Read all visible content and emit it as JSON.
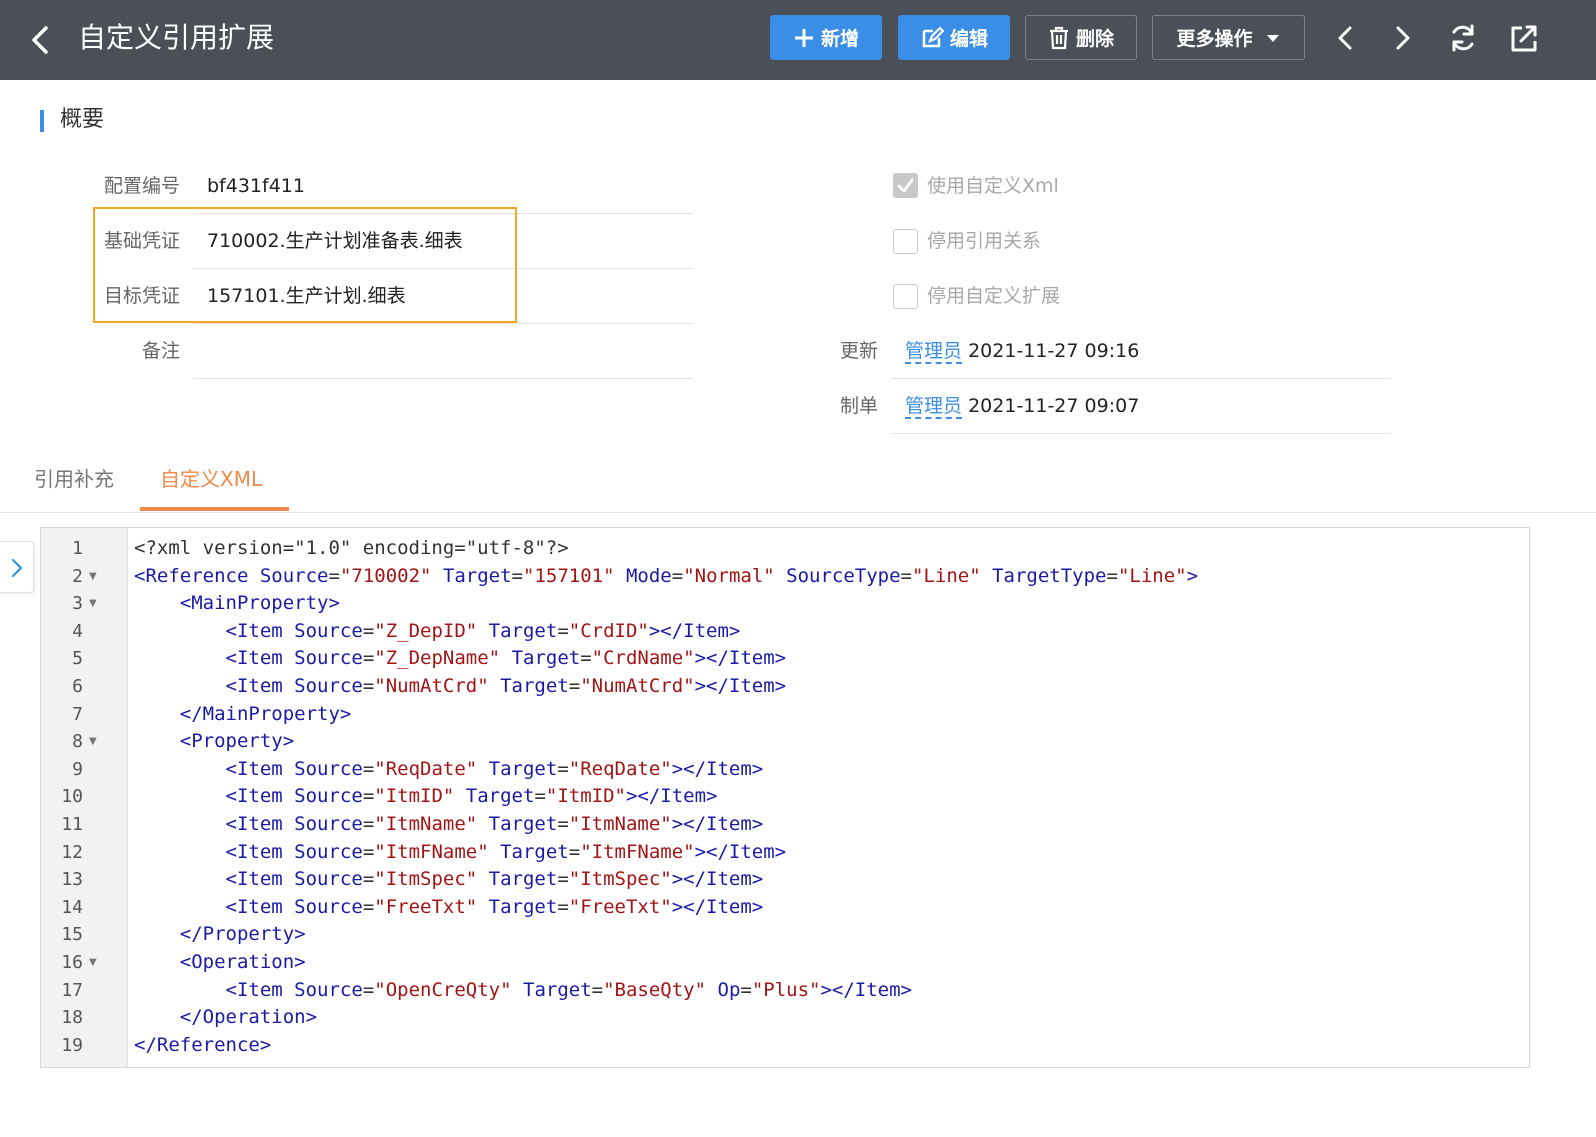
{
  "header": {
    "title": "自定义引用扩展",
    "buttons": {
      "add": "新增",
      "edit": "编辑",
      "delete": "删除",
      "more": "更多操作"
    }
  },
  "overview": {
    "section_title": "概要",
    "fields": {
      "config_no": {
        "label": "配置编号",
        "value": "bf431f411"
      },
      "base_voucher": {
        "label": "基础凭证",
        "value": "710002.生产计划准备表.细表"
      },
      "target_voucher": {
        "label": "目标凭证",
        "value": "157101.生产计划.细表"
      },
      "remark": {
        "label": "备注",
        "value": ""
      },
      "updated": {
        "label": "更新",
        "user": "管理员",
        "time": "2021-11-27 09:16"
      },
      "created": {
        "label": "制单",
        "user": "管理员",
        "time": "2021-11-27 09:07"
      }
    },
    "checkboxes": {
      "use_custom_xml": {
        "label": "使用自定义Xml",
        "checked": true
      },
      "disable_reference": {
        "label": "停用引用关系",
        "checked": false
      },
      "disable_custom_ext": {
        "label": "停用自定义扩展",
        "checked": false
      }
    }
  },
  "tabs": {
    "tab1": "引用补充",
    "tab2": "自定义XML"
  },
  "editor": {
    "line_numbers": [
      "1",
      "2",
      "3",
      "4",
      "5",
      "6",
      "7",
      "8",
      "9",
      "10",
      "11",
      "12",
      "13",
      "14",
      "15",
      "16",
      "17",
      "18",
      "19"
    ],
    "lines": [
      "<?xml version=\"1.0\" encoding=\"utf-8\"?>",
      "<Reference Source=\"710002\" Target=\"157101\" Mode=\"Normal\" SourceType=\"Line\" TargetType=\"Line\">",
      "    <MainProperty>",
      "        <Item Source=\"Z_DepID\" Target=\"CrdID\"></Item>",
      "        <Item Source=\"Z_DepName\" Target=\"CrdName\"></Item>",
      "        <Item Source=\"NumAtCrd\" Target=\"NumAtCrd\"></Item>",
      "    </MainProperty>",
      "    <Property>",
      "        <Item Source=\"ReqDate\" Target=\"ReqDate\"></Item>",
      "        <Item Source=\"ItmID\" Target=\"ItmID\"></Item>",
      "        <Item Source=\"ItmName\" Target=\"ItmName\"></Item>",
      "        <Item Source=\"ItmFName\" Target=\"ItmFName\"></Item>",
      "        <Item Source=\"ItmSpec\" Target=\"ItmSpec\"></Item>",
      "        <Item Source=\"FreeTxt\" Target=\"FreeTxt\"></Item>",
      "    </Property>",
      "    <Operation>",
      "        <Item Source=\"OpenCreQty\" Target=\"BaseQty\" Op=\"Plus\"></Item>",
      "    </Operation>",
      "</Reference>"
    ],
    "foldable_lines": [
      2,
      3,
      8,
      16
    ]
  }
}
